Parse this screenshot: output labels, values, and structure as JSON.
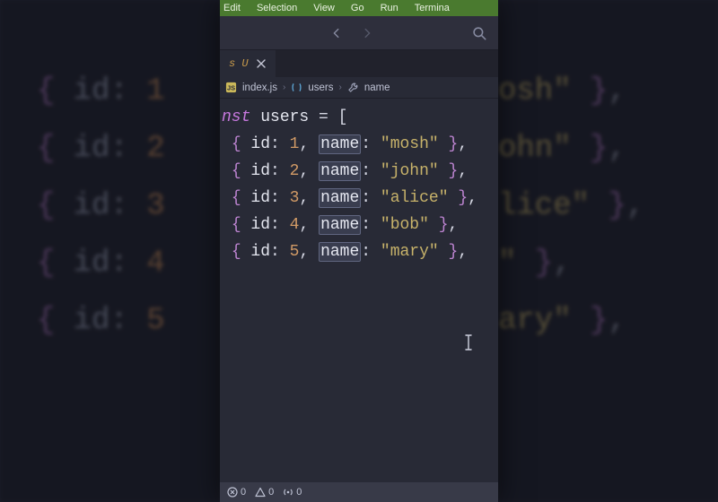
{
  "menubar": {
    "items": [
      "Edit",
      "Selection",
      "View",
      "Go",
      "Run",
      "Termina"
    ]
  },
  "tab": {
    "partial_label": "s U",
    "close_glyph": "×"
  },
  "breadcrumb": {
    "file": "index.js",
    "symbol": "users",
    "property": "name"
  },
  "code": {
    "decl_keyword_partial": "nst",
    "decl_ident": "users",
    "decl_op": "=",
    "decl_bracket": "[",
    "rows": [
      {
        "id": 1,
        "name": "mosh"
      },
      {
        "id": 2,
        "name": "john"
      },
      {
        "id": 3,
        "name": "alice"
      },
      {
        "id": 4,
        "name": "bob"
      },
      {
        "id": 5,
        "name": "mary"
      }
    ],
    "key_id": "id",
    "key_name": "name"
  },
  "statusbar": {
    "errors": 0,
    "warnings": 0,
    "info": 0
  },
  "bg_echo_right_fragments": [
    "osh\"",
    "ohn\"",
    "lice\"",
    "\"",
    "ary\""
  ]
}
